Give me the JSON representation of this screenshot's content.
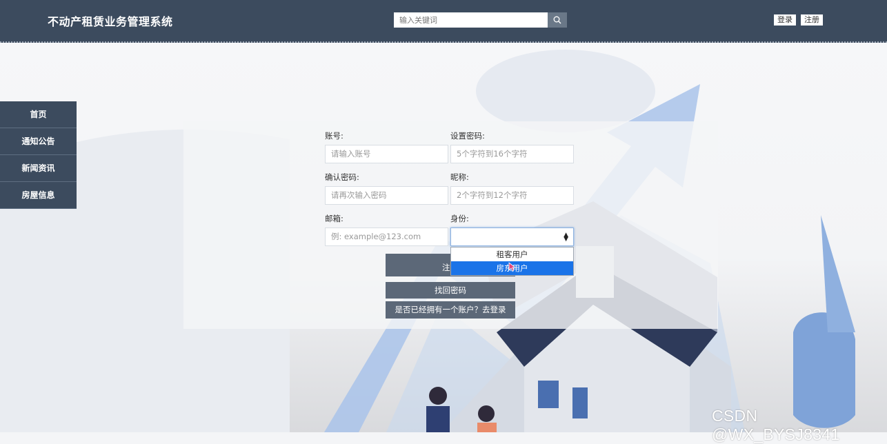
{
  "header": {
    "title": "不动产租赁业务管理系统",
    "search_placeholder": "输入关键词",
    "login_label": "登录",
    "register_label": "注册"
  },
  "sidebar": {
    "items": [
      {
        "label": "首页"
      },
      {
        "label": "通知公告"
      },
      {
        "label": "新闻资讯"
      },
      {
        "label": "房屋信息"
      }
    ]
  },
  "form": {
    "account_label": "账号:",
    "account_placeholder": "请输入账号",
    "password_label": "设置密码:",
    "password_placeholder": "5个字符到16个字符",
    "confirm_label": "确认密码:",
    "confirm_placeholder": "请再次输入密码",
    "nickname_label": "昵称:",
    "nickname_placeholder": "2个字符到12个字符",
    "email_label": "邮箱:",
    "email_placeholder": "例: example@123.com",
    "role_label": "身份:",
    "role_value": "",
    "role_options": [
      "租客用户",
      "房东用户"
    ],
    "register_button": "注",
    "forgot_button": "找回密码",
    "login_link": "是否已经拥有一个账户？去登录"
  },
  "watermark": "CSDN @WX_BYSJ8341",
  "colors": {
    "header_bg": "#3c4b5e",
    "button_bg": "#5c6878",
    "option_highlight": "#1a73e8"
  }
}
